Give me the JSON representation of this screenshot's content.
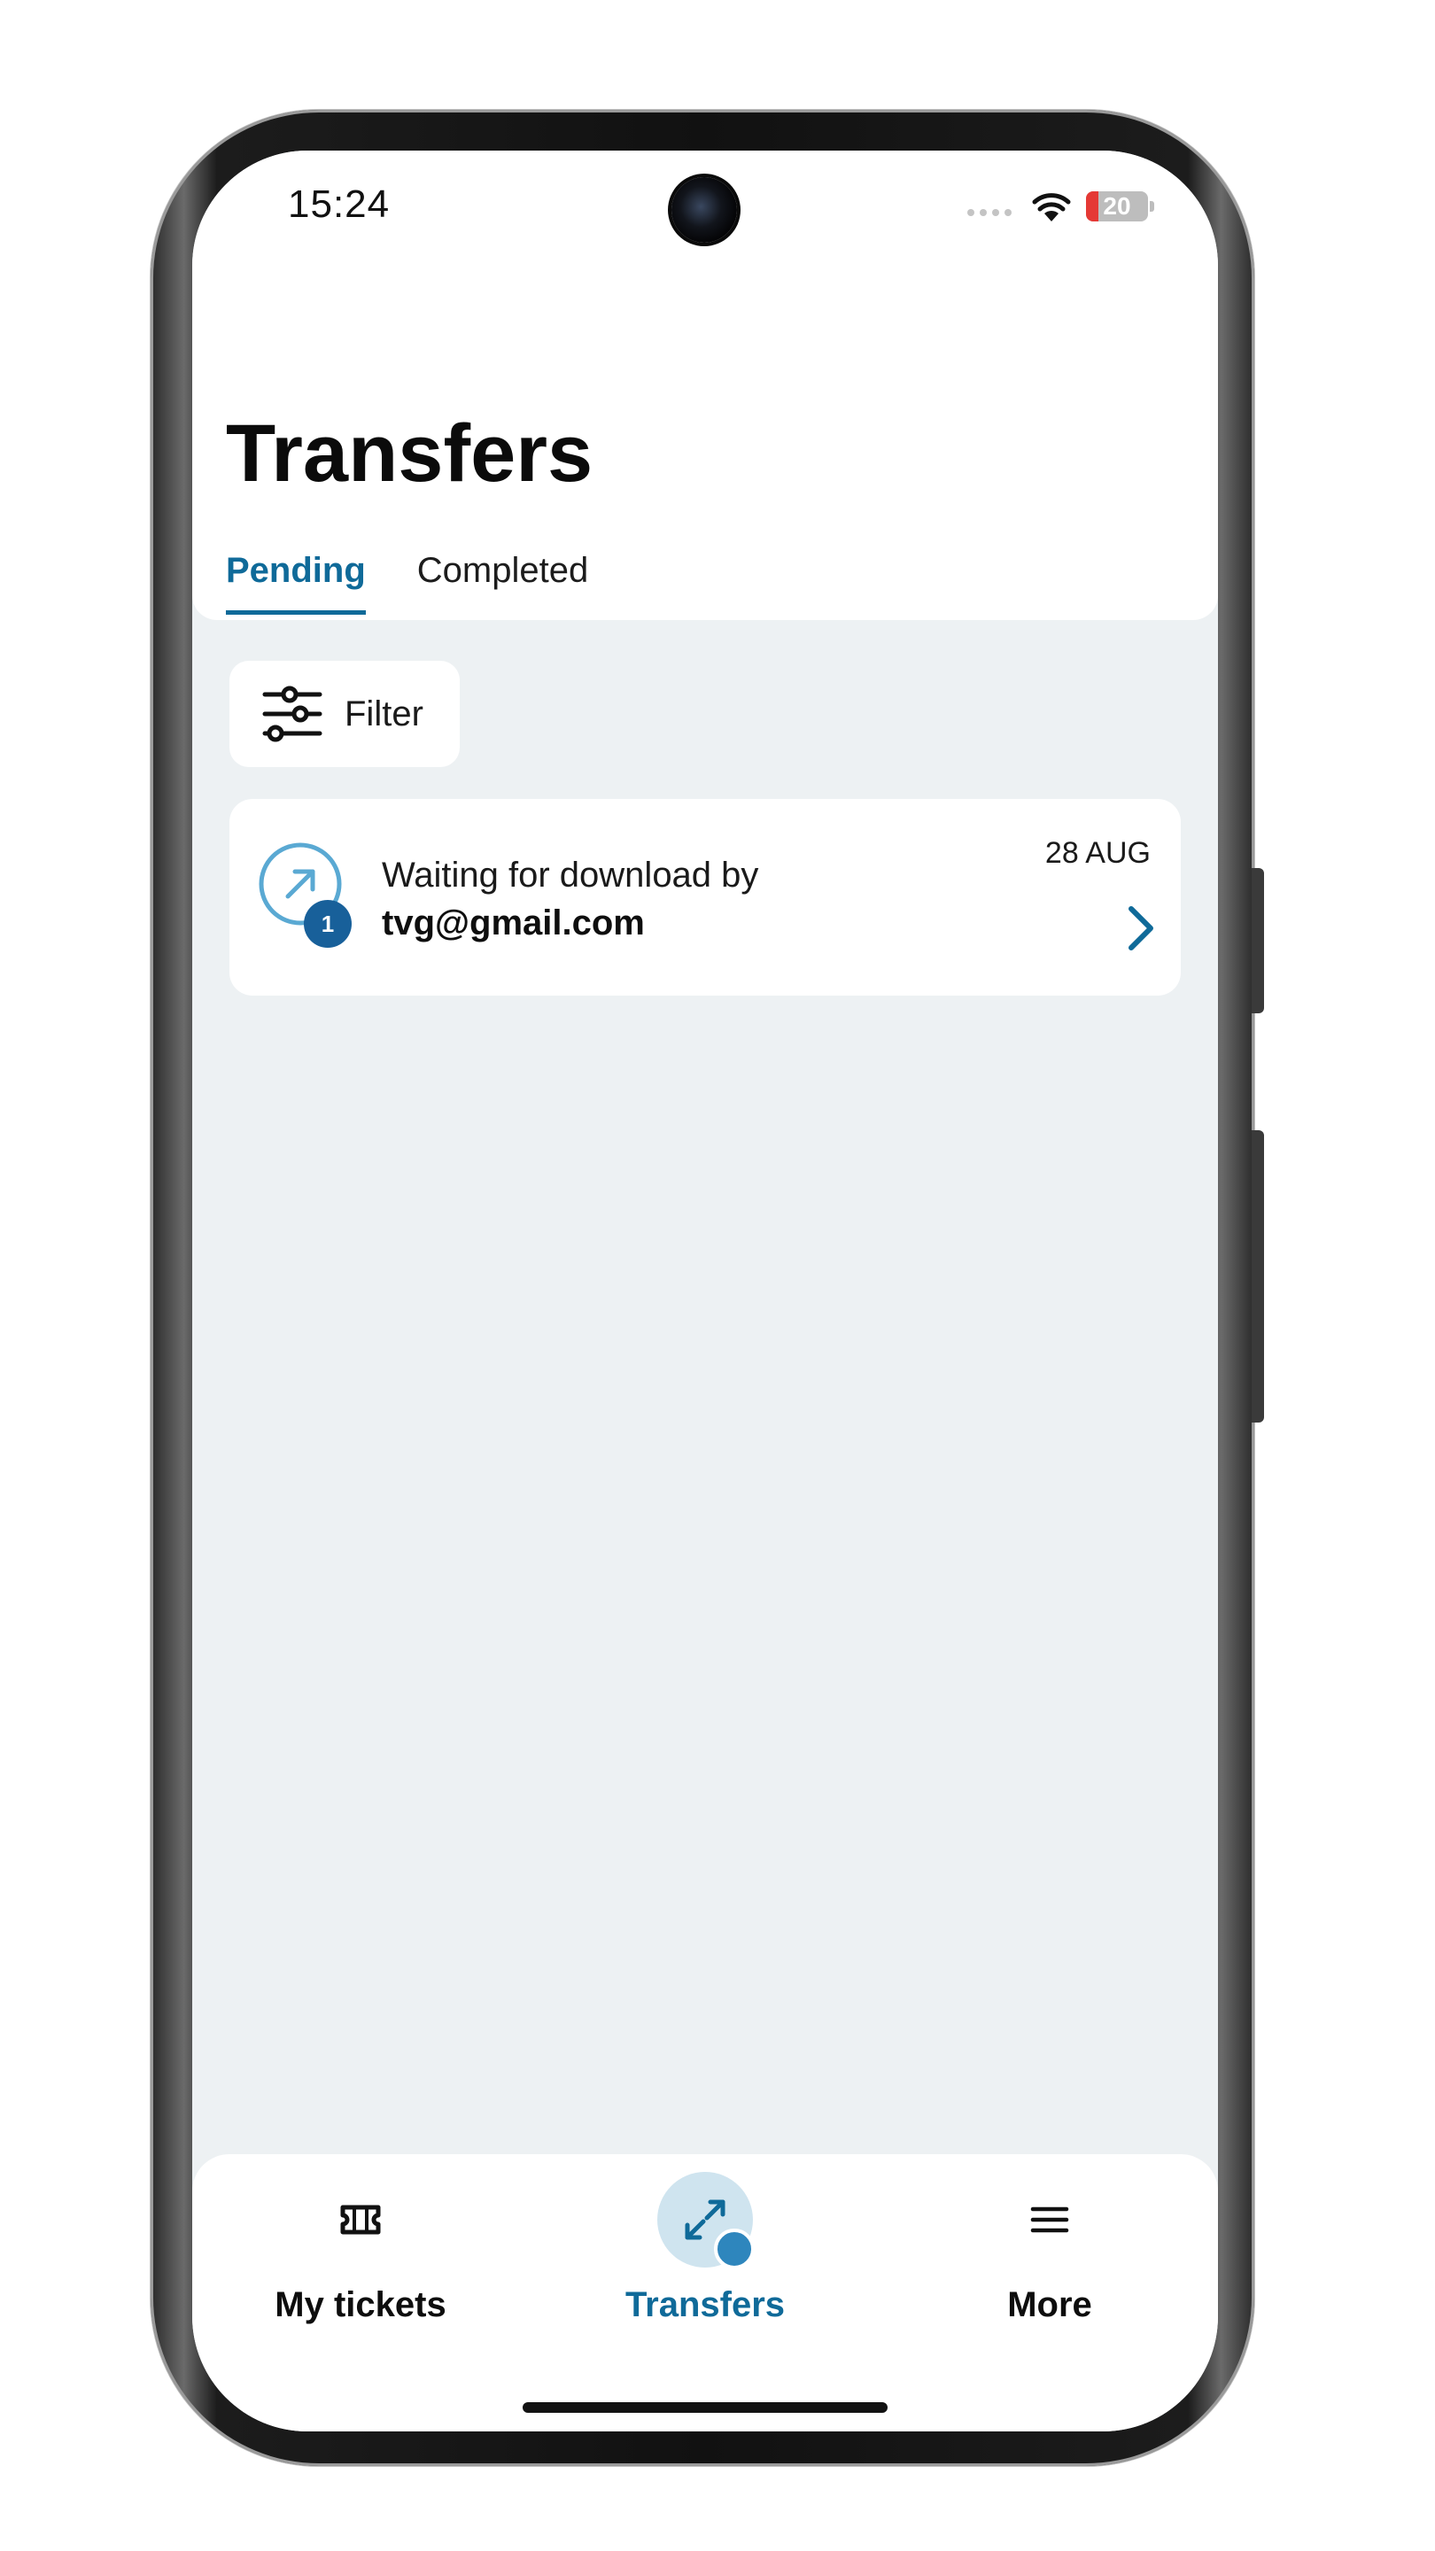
{
  "status_bar": {
    "time": "15:24",
    "battery_level": "20",
    "battery_fraction": 0.2
  },
  "header": {
    "title": "Transfers"
  },
  "tabs": [
    {
      "label": "Pending",
      "active": true
    },
    {
      "label": "Completed",
      "active": false
    }
  ],
  "filter": {
    "label": "Filter",
    "icon": "sliders-icon"
  },
  "transfers": [
    {
      "status_text": "Waiting for download by",
      "recipient": "tvg@gmail.com",
      "date": "28 AUG",
      "count": "1",
      "icon": "outgoing-arrow-icon"
    }
  ],
  "bottom_nav": {
    "items": [
      {
        "label": "My tickets",
        "icon": "ticket-icon",
        "active": false
      },
      {
        "label": "Transfers",
        "icon": "transfer-arrows-icon",
        "active": true
      },
      {
        "label": "More",
        "icon": "menu-icon",
        "active": false
      }
    ]
  },
  "colors": {
    "accent": "#0f6a99",
    "background": "#edf1f3",
    "badge": "#18609a",
    "battery_low": "#e53935"
  }
}
